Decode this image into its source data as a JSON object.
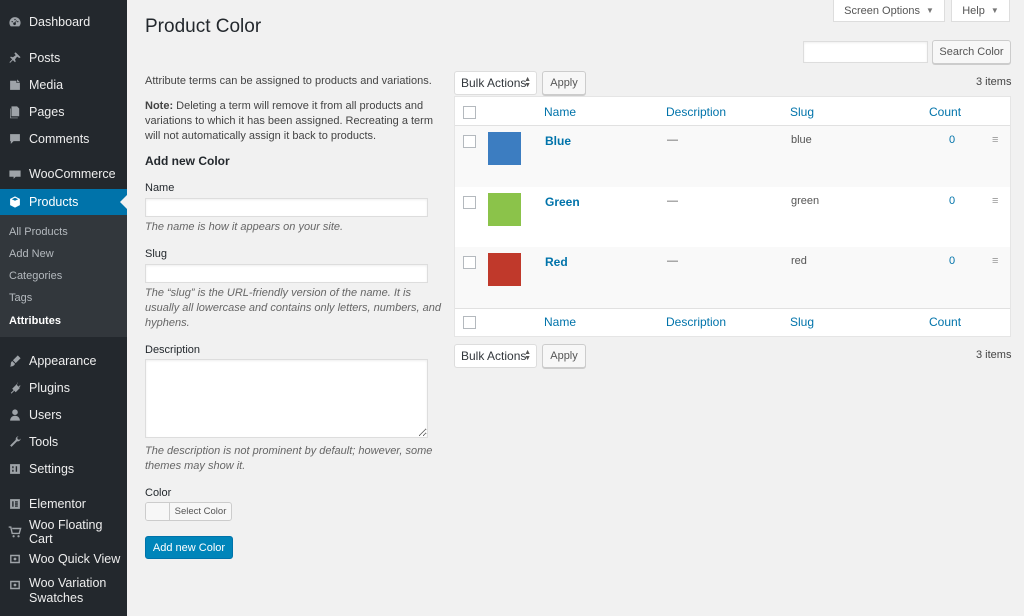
{
  "sidebar": {
    "items": [
      {
        "label": "Dashboard",
        "icon": "dashboard-icon"
      },
      {
        "label": "Posts",
        "icon": "pin-icon"
      },
      {
        "label": "Media",
        "icon": "media-icon"
      },
      {
        "label": "Pages",
        "icon": "pages-icon"
      },
      {
        "label": "Comments",
        "icon": "comment-icon"
      },
      {
        "label": "WooCommerce",
        "icon": "woo-icon"
      },
      {
        "label": "Products",
        "icon": "box-icon"
      },
      {
        "label": "Appearance",
        "icon": "brush-icon"
      },
      {
        "label": "Plugins",
        "icon": "plug-icon"
      },
      {
        "label": "Users",
        "icon": "user-icon"
      },
      {
        "label": "Tools",
        "icon": "wrench-icon"
      },
      {
        "label": "Settings",
        "icon": "settings-icon"
      },
      {
        "label": "Elementor",
        "icon": "elementor-icon"
      },
      {
        "label": "Woo Floating Cart",
        "icon": "cart-icon"
      },
      {
        "label": "Woo Quick View",
        "icon": "eye-icon"
      },
      {
        "label": "Woo Variation",
        "label2": "Swatches",
        "icon": "swatch-icon"
      }
    ],
    "submenu": [
      "All Products",
      "Add New",
      "Categories",
      "Tags",
      "Attributes"
    ]
  },
  "top": {
    "screen_options": "Screen Options",
    "help": "Help"
  },
  "page_title": "Product Color",
  "search": {
    "button": "Search Color",
    "value": ""
  },
  "form": {
    "intro": "Attribute terms can be assigned to products and variations.",
    "note_label": "Note:",
    "note_line1": " Deleting a term will remove it from all products and",
    "note_line2": "variations to which it has been assigned. Recreating a term",
    "note_line3": "will not automatically assign it back to products.",
    "heading": "Add new Color",
    "name_label": "Name",
    "name_help": "The name is how it appears on your site.",
    "slug_label": "Slug",
    "slug_help1": "The “slug” is the URL-friendly version of the name. It is",
    "slug_help2": "usually all lowercase and contains only letters, numbers, and",
    "slug_help3": "hyphens.",
    "desc_label": "Description",
    "desc_help1": "The description is not prominent by default; however, some",
    "desc_help2": "themes may show it.",
    "color_label": "Color",
    "select_color": "Select Color",
    "submit": "Add new Color"
  },
  "table": {
    "bulk_actions": "Bulk Actions",
    "apply": "Apply",
    "items_count": "3 items",
    "headers": {
      "name": "Name",
      "description": "Description",
      "slug": "Slug",
      "count": "Count"
    },
    "rows": [
      {
        "name": "Blue",
        "description": "—",
        "slug": "blue",
        "count": "0",
        "color": "#3c7dc1"
      },
      {
        "name": "Green",
        "description": "—",
        "slug": "green",
        "count": "0",
        "color": "#8bc34a"
      },
      {
        "name": "Red",
        "description": "—",
        "slug": "red",
        "count": "0",
        "color": "#c0392b"
      }
    ]
  }
}
